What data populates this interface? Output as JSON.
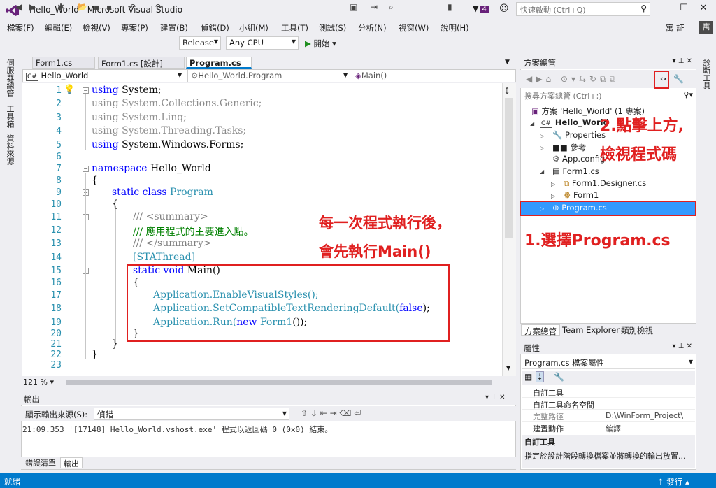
{
  "window": {
    "title": "Hello_World - Microsoft Visual Studio",
    "notification_count": "4",
    "quick_launch_placeholder": "快速啟動 (Ctrl+Q)",
    "user": "寓 証",
    "user_initial": "寓"
  },
  "menu": [
    "檔案(F)",
    "編輯(E)",
    "檢視(V)",
    "專案(P)",
    "建置(B)",
    "偵錯(D)",
    "小組(M)",
    "工具(T)",
    "測試(S)",
    "分析(N)",
    "視窗(W)",
    "說明(H)"
  ],
  "toolbar": {
    "config": "Release",
    "platform": "Any CPU",
    "start": "開始"
  },
  "left_strip": [
    "伺服器總管",
    "工具箱",
    "資料來源"
  ],
  "right_strip": "診斷工具",
  "doc_tabs": [
    "Form1.cs",
    "Form1.cs [設計]",
    "Program.cs"
  ],
  "nav": {
    "project": "Hello_World",
    "class": "Hello_World.Program",
    "member": "Main()"
  },
  "code": {
    "line_numbers": [
      "1",
      "2",
      "3",
      "4",
      "5",
      "6",
      "7",
      "8",
      "9",
      "10",
      "11",
      "12",
      "13",
      "14",
      "15",
      "16",
      "17",
      "18",
      "19",
      "20",
      "21",
      "22",
      "23"
    ],
    "using1_kw": "using",
    "using1_ns": " System;",
    "using2": "using System.Collections.Generic;",
    "using3": "using System.Linq;",
    "using4": "using System.Threading.Tasks;",
    "using5_kw": "using",
    "using5_ns": " System.Windows.Forms;",
    "ns_kw": "namespace",
    "ns_name": " Hello_World",
    "brace_open": "{",
    "brace_close": "}",
    "class_kw": "static class ",
    "class_name": "Program",
    "summary_open": "/// <summary>",
    "summary_text": "/// 應用程式的主要進入點。",
    "summary_close": "/// </summary>",
    "attr": "[STAThread]",
    "main_kw": "static void ",
    "main_name": "Main()",
    "app1": "Application.EnableVisualStyles();",
    "app2_a": "Application.SetCompatibleTextRenderingDefault(",
    "app2_b": "false",
    "app2_c": ");",
    "app3_a": "Application.Run(",
    "app3_b": "new ",
    "app3_c": "Form1",
    "app3_d": "());"
  },
  "zoom": "121 %",
  "output": {
    "title": "輸出",
    "source_label": "顯示輸出來源(S):",
    "source_value": "偵錯",
    "line": "21:09.353  '[17148] Hello_World.vshost.exe' 程式以返回碼 0 (0x0) 結束。"
  },
  "bottom_tabs": [
    "錯誤清單",
    "輸出"
  ],
  "status": {
    "left": "就緒",
    "right": "發行"
  },
  "solution": {
    "title": "方案總管",
    "search_placeholder": "搜尋方案總管 (Ctrl+;)",
    "nodes": [
      "方案 'Hello_World' (1 專案)",
      "Hello_World",
      "Properties",
      "參考",
      "App.config",
      "Form1.cs",
      "Form1.Designer.cs",
      "Form1",
      "Program.cs"
    ]
  },
  "sol_tabs": [
    "方案總管",
    "Team Explorer",
    "類別檢視"
  ],
  "properties": {
    "title": "屬性",
    "object": "Program.cs 檔案屬性",
    "rows": [
      {
        "k": "自訂工具",
        "v": ""
      },
      {
        "k": "自訂工具命名空間",
        "v": ""
      },
      {
        "k": "完整路徑",
        "v": "D:\\WinForm_Project\\"
      },
      {
        "k": "建置動作",
        "v": "編譯"
      }
    ],
    "desc_title": "自訂工具",
    "desc_text": "指定於設計階段轉換檔案並將轉換的輸出放置..."
  },
  "annotations": {
    "step1": "1.選擇Program.cs",
    "step2_line1": "2.點擊上方,",
    "step2_line2": "檢視程式碼",
    "main_note_line1": "每一次程式執行後，",
    "main_note_line2": "會先執行Main()"
  },
  "colors": {
    "accent": "#007acc",
    "keyword": "#0000ff",
    "type": "#2b91af",
    "comment": "#008000",
    "annotation": "#e02020",
    "selection": "#3399ff"
  }
}
